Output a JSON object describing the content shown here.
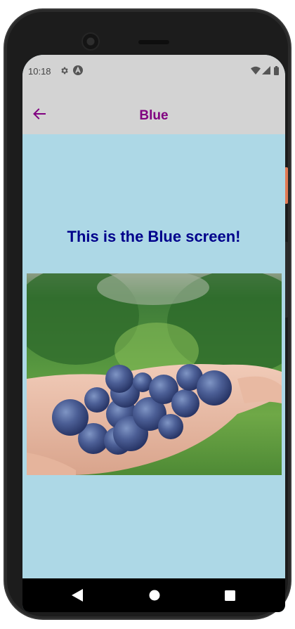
{
  "status_bar": {
    "time": "10:18",
    "icons": [
      "settings-gear-icon",
      "app-a-icon",
      "wifi-icon",
      "signal-icon",
      "battery-icon"
    ]
  },
  "app_bar": {
    "title": "Blue",
    "back_icon": "arrow-left-icon",
    "title_color": "#800080",
    "background": "#d3d3d3"
  },
  "content": {
    "heading": "This is the Blue screen!",
    "heading_color": "#00008b",
    "background": "#add8e6",
    "image": "blueberries-in-hand-photo"
  },
  "nav_bar": {
    "icons": [
      "back-triangle-icon",
      "home-circle-icon",
      "recents-square-icon"
    ]
  }
}
